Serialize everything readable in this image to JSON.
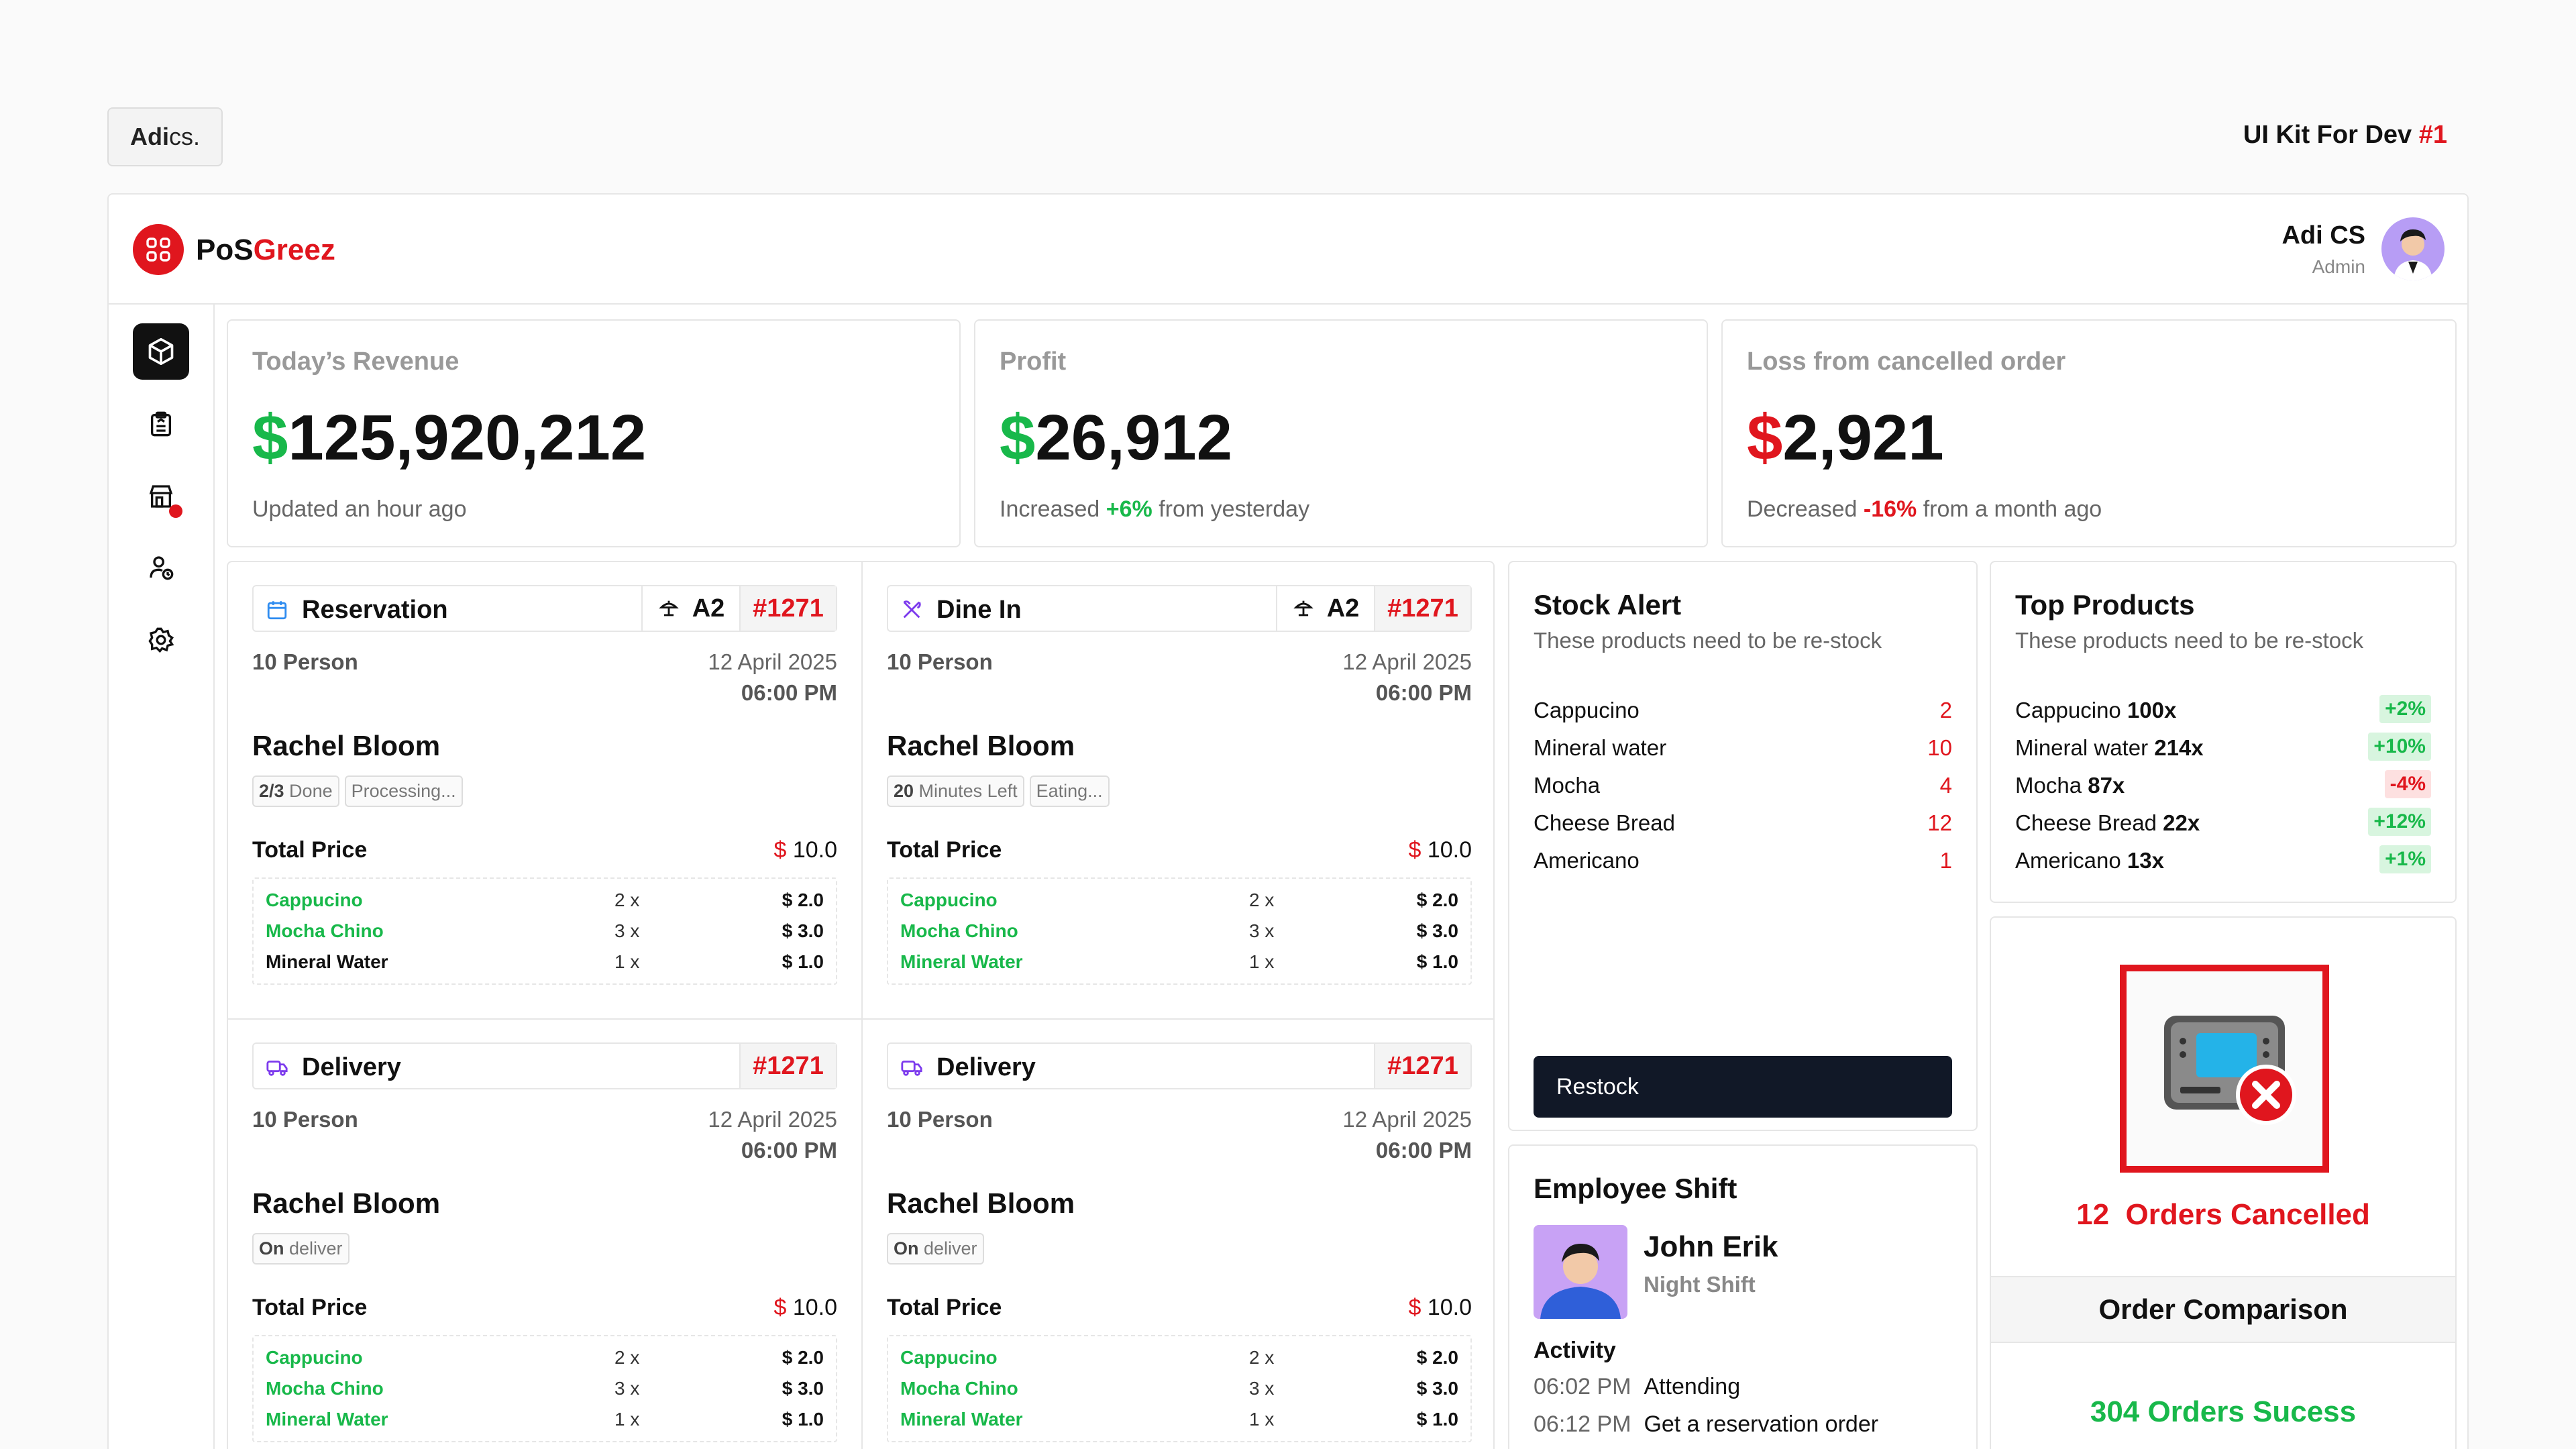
{
  "header": {
    "brand_bold": "Adi",
    "brand_rest": "cs.",
    "kit_label": "UI Kit For Dev ",
    "kit_number": "#1"
  },
  "app": {
    "logo_prefix": "PoS",
    "logo_suffix": "Greez",
    "user_name": "Adi CS",
    "user_role": "Admin"
  },
  "sidebar": {
    "items": [
      {
        "icon": "box-icon",
        "active": true
      },
      {
        "icon": "clipboard-icon",
        "active": false
      },
      {
        "icon": "store-icon",
        "active": false,
        "notification": true
      },
      {
        "icon": "user-clock-icon",
        "active": false
      },
      {
        "icon": "gear-icon",
        "active": false
      }
    ]
  },
  "metrics": [
    {
      "label": "Today’s Revenue",
      "currency": "$",
      "value": "125,920,212",
      "sub_pre": "Updated an hour ago",
      "sub_hl": "",
      "sub_post": ""
    },
    {
      "label": "Profit",
      "currency": "$",
      "value": "26,912",
      "sub_pre": "Increased ",
      "sub_hl": "+6%",
      "sub_post": " from yesterday"
    },
    {
      "label": "Loss from cancelled order",
      "currency": "$",
      "value": "2,921",
      "sub_pre": "Decreased ",
      "sub_hl": "-16%",
      "sub_post": " from a month ago"
    }
  ],
  "orders": [
    {
      "type": "Reservation",
      "table": "A2",
      "number": "#1271",
      "persons": "10 Person",
      "date": "12 April 2025",
      "time": "06:00 PM",
      "customer": "Rachel Bloom",
      "tag1_b": "2/3",
      "tag1_r": " Done",
      "tag2": "Processing...",
      "total_label": "Total Price",
      "total_cur": "$",
      "total": " 10.0",
      "items": [
        {
          "name": "Cappucino",
          "qty": "2 x",
          "price": "$ 2.0"
        },
        {
          "name": "Mocha Chino",
          "qty": "3 x",
          "price": "$ 3.0"
        },
        {
          "name": "Mineral Water",
          "qty": "1 x",
          "price": "$ 1.0"
        }
      ]
    },
    {
      "type": "Dine In",
      "table": "A2",
      "number": "#1271",
      "persons": "10 Person",
      "date": "12 April 2025",
      "time": "06:00 PM",
      "customer": "Rachel Bloom",
      "tag1_b": "20",
      "tag1_r": " Minutes Left",
      "tag2": "Eating...",
      "total_label": "Total Price",
      "total_cur": "$",
      "total": " 10.0",
      "items": [
        {
          "name": "Cappucino",
          "qty": "2 x",
          "price": "$ 2.0"
        },
        {
          "name": "Mocha Chino",
          "qty": "3 x",
          "price": "$ 3.0"
        },
        {
          "name": "Mineral Water",
          "qty": "1 x",
          "price": "$ 1.0"
        }
      ]
    },
    {
      "type": "Delivery",
      "number": "#1271",
      "persons": "10 Person",
      "date": "12 April 2025",
      "time": "06:00 PM",
      "customer": "Rachel Bloom",
      "tag1_b": "On",
      "tag1_r": " deliver",
      "total_label": "Total Price",
      "total_cur": "$",
      "total": " 10.0",
      "items": [
        {
          "name": "Cappucino",
          "qty": "2 x",
          "price": "$ 2.0"
        },
        {
          "name": "Mocha Chino",
          "qty": "3 x",
          "price": "$ 3.0"
        },
        {
          "name": "Mineral Water",
          "qty": "1 x",
          "price": "$ 1.0"
        }
      ]
    },
    {
      "type": "Delivery",
      "number": "#1271",
      "persons": "10 Person",
      "date": "12 April 2025",
      "time": "06:00 PM",
      "customer": "Rachel Bloom",
      "tag1_b": "On",
      "tag1_r": " deliver",
      "total_label": "Total Price",
      "total_cur": "$",
      "total": " 10.0",
      "items": [
        {
          "name": "Cappucino",
          "qty": "2 x",
          "price": "$ 2.0"
        },
        {
          "name": "Mocha Chino",
          "qty": "3 x",
          "price": "$ 3.0"
        },
        {
          "name": "Mineral Water",
          "qty": "1 x",
          "price": "$ 1.0"
        }
      ]
    }
  ],
  "stock_alert": {
    "title": "Stock Alert",
    "subtitle": "These products need to be re-stock",
    "items": [
      {
        "name": "Cappucino",
        "qty": "2"
      },
      {
        "name": "Mineral water",
        "qty": "10"
      },
      {
        "name": "Mocha",
        "qty": "4"
      },
      {
        "name": "Cheese Bread",
        "qty": "12"
      },
      {
        "name": "Americano",
        "qty": "1"
      }
    ],
    "button": "Restock"
  },
  "top_products": {
    "title": "Top Products",
    "subtitle": "These products need to be re-stock",
    "items": [
      {
        "name": "Cappucino ",
        "count": "100x",
        "change": "+2%",
        "dir": "up"
      },
      {
        "name": "Mineral water ",
        "count": "214x",
        "change": "+10%",
        "dir": "up"
      },
      {
        "name": "Mocha ",
        "count": "87x",
        "change": "-4%",
        "dir": "dn"
      },
      {
        "name": "Cheese Bread ",
        "count": "22x",
        "change": "+12%",
        "dir": "up"
      },
      {
        "name": "Americano ",
        "count": "13x",
        "change": "+1%",
        "dir": "up"
      }
    ]
  },
  "cancelled": {
    "count": "12",
    "label": "Orders Cancelled"
  },
  "comparison": {
    "title": "Order Comparison",
    "success": "304 Orders Sucess"
  },
  "employee": {
    "title": "Employee Shift",
    "name": "John Erik",
    "shift": "Night Shift",
    "activity_label": "Activity",
    "activities": [
      {
        "time": "06:02 PM",
        "text": "Attending"
      },
      {
        "time": "06:12 PM",
        "text": "Get a reservation order"
      }
    ]
  },
  "colors": {
    "accent": "#e0161e",
    "success": "#18b84a",
    "dark": "#111827"
  }
}
